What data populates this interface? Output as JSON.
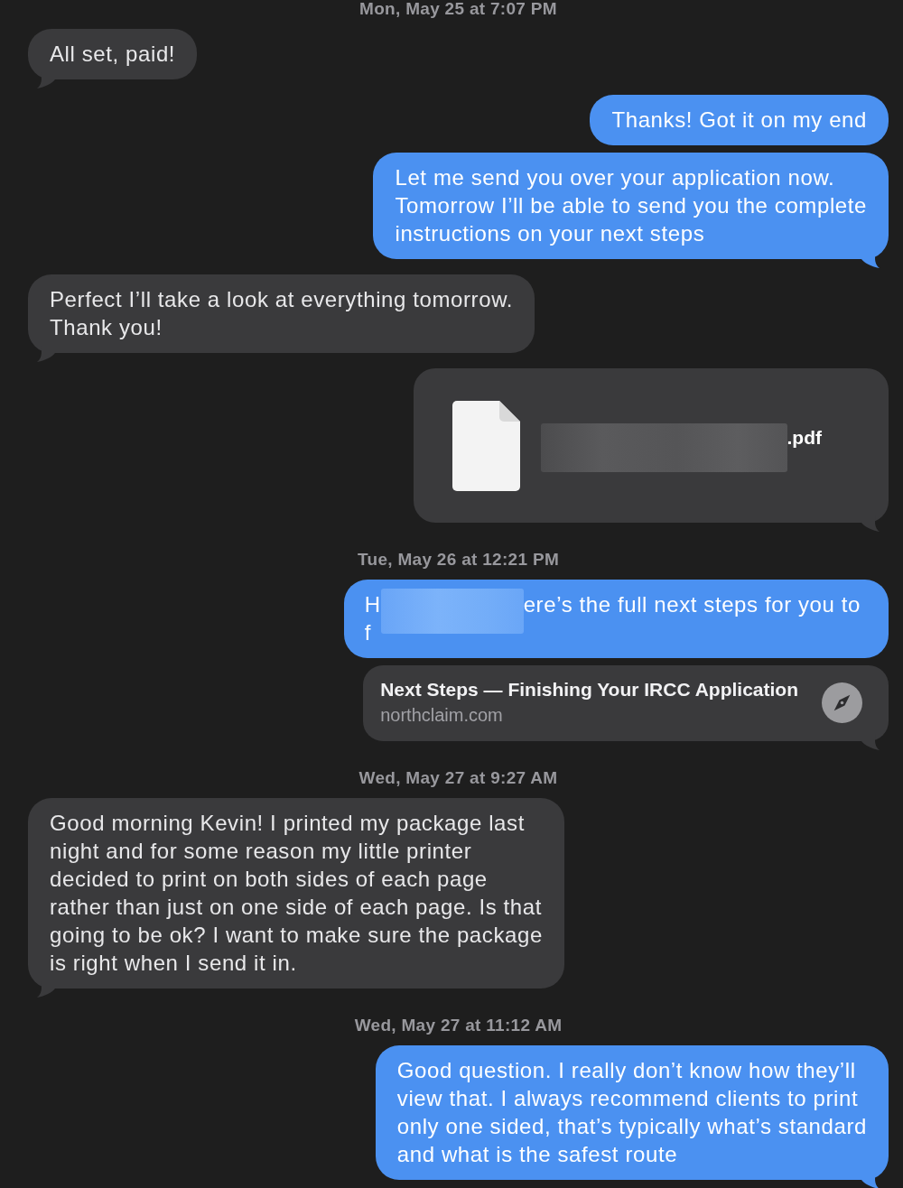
{
  "messages": [
    {
      "kind": "timestamp",
      "text": "Mon, May 25 at 7:07 PM"
    },
    {
      "kind": "text",
      "outgoing": false,
      "tail": true,
      "text": "All set, paid!"
    },
    {
      "kind": "text",
      "outgoing": true,
      "tail": false,
      "text": "Thanks! Got it on my end"
    },
    {
      "kind": "text",
      "outgoing": true,
      "tail": true,
      "text": "Let me send you over your application now.\nTomorrow I’ll be able to send you the complete\ninstructions on your next steps"
    },
    {
      "kind": "text",
      "outgoing": false,
      "tail": true,
      "text": "Perfect I’ll take a look at everything tomorrow.\nThank you!"
    },
    {
      "kind": "attachment",
      "outgoing": true,
      "tail": true,
      "redacted": true,
      "file_name": ".pdf"
    },
    {
      "kind": "timestamp",
      "text": "Tue, May 26 at 12:21 PM"
    },
    {
      "kind": "redacted_text",
      "outgoing": true,
      "tail": false,
      "lines": [
        [
          {
            "kind": "text",
            "text": "H"
          },
          {
            "kind": "redaction"
          },
          {
            "kind": "text",
            "text": "ere’s the full next steps for you to"
          }
        ],
        [
          {
            "kind": "text",
            "text": "f"
          }
        ]
      ]
    },
    {
      "kind": "link_preview",
      "outgoing": true,
      "tail": true,
      "title": "Next Steps — Finishing Your IRCC Application",
      "domain": "northclaim.com"
    },
    {
      "kind": "timestamp",
      "text": "Wed, May 27 at 9:27 AM"
    },
    {
      "kind": "text",
      "outgoing": false,
      "tail": true,
      "text": "Good morning Kevin! I printed my package last\nnight and for some reason my little printer\ndecided to print on both sides of each page\nrather than just on one side of each page. Is that\ngoing to be ok? I want to make sure the package\nis right when I send it in."
    },
    {
      "kind": "timestamp",
      "text": "Wed, May 27 at 11:12 AM"
    },
    {
      "kind": "text",
      "outgoing": true,
      "tail": true,
      "text": "Good question. I really don’t know how they’ll\nview that. I always recommend clients to print\nonly one sided, that’s typically what’s standard\nand what is the safest route"
    }
  ]
}
